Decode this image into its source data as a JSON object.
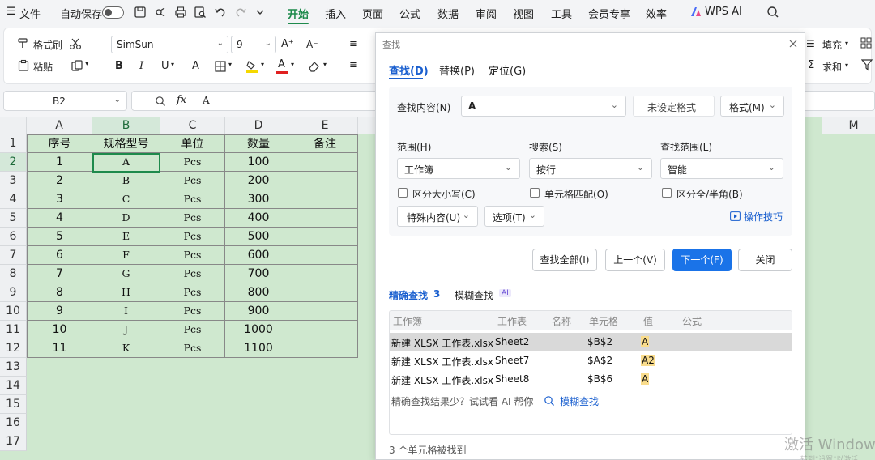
{
  "menubar": {
    "file": "文件",
    "autosave": "自动保存",
    "tabs": [
      "开始",
      "插入",
      "页面",
      "公式",
      "数据",
      "审阅",
      "视图",
      "工具",
      "会员专享",
      "效率"
    ],
    "wps_ai": "WPS AI"
  },
  "ribbon": {
    "format_painter": "格式刷",
    "paste": "粘贴",
    "font": "SimSun",
    "font_size": "9",
    "fill": "填充",
    "sum": "求和"
  },
  "formula_bar": {
    "name_box": "B2",
    "fx": "fx",
    "content": "A"
  },
  "sheet": {
    "columns": [
      "A",
      "B",
      "C",
      "D",
      "E",
      "M"
    ],
    "rows": [
      "1",
      "2",
      "3",
      "4",
      "5",
      "6",
      "7",
      "8",
      "9",
      "10",
      "11",
      "12",
      "13",
      "14",
      "15",
      "16",
      "17"
    ],
    "header_row": [
      "序号",
      "规格型号",
      "单位",
      "数量",
      "备注"
    ],
    "data": [
      [
        "1",
        "A",
        "Pcs",
        "100",
        ""
      ],
      [
        "2",
        "B",
        "Pcs",
        "200",
        ""
      ],
      [
        "3",
        "C",
        "Pcs",
        "300",
        ""
      ],
      [
        "4",
        "D",
        "Pcs",
        "400",
        ""
      ],
      [
        "5",
        "E",
        "Pcs",
        "500",
        ""
      ],
      [
        "6",
        "F",
        "Pcs",
        "600",
        ""
      ],
      [
        "7",
        "G",
        "Pcs",
        "700",
        ""
      ],
      [
        "8",
        "H",
        "Pcs",
        "800",
        ""
      ],
      [
        "9",
        "I",
        "Pcs",
        "900",
        ""
      ],
      [
        "10",
        "J",
        "Pcs",
        "1000",
        ""
      ],
      [
        "11",
        "K",
        "Pcs",
        "1100",
        ""
      ]
    ]
  },
  "dialog": {
    "title": "查找",
    "tabs": [
      "查找(D)",
      "替换(P)",
      "定位(G)"
    ],
    "find_label": "查找内容(N)",
    "find_value": "A",
    "format_status": "未设定格式",
    "format_button": "格式(M)",
    "scope_label": "范围(H)",
    "scope_value": "工作簿",
    "search_label": "搜索(S)",
    "search_value": "按行",
    "lookin_label": "查找范围(L)",
    "lookin_value": "智能",
    "match_case": "区分大小写(C)",
    "match_cell": "单元格匹配(O)",
    "match_width": "区分全/半角(B)",
    "special": "特殊内容(U)",
    "options": "选项(T)",
    "tips": "操作技巧",
    "find_all": "查找全部(I)",
    "prev": "上一个(V)",
    "next": "下一个(F)",
    "close": "关闭",
    "mode_exact": "精确查找",
    "mode_exact_count": "3",
    "mode_fuzzy": "模糊查找",
    "ai_badge": "AI",
    "result_headers": [
      "工作簿",
      "工作表",
      "名称",
      "单元格",
      "值",
      "公式"
    ],
    "results": [
      {
        "workbook": "新建 XLSX 工作表.xlsx",
        "sheet": "Sheet2",
        "cell": "$B$2",
        "value": "A"
      },
      {
        "workbook": "新建 XLSX 工作表.xlsx",
        "sheet": "Sheet7",
        "cell": "$A$2",
        "value": "A2"
      },
      {
        "workbook": "新建 XLSX 工作表.xlsx",
        "sheet": "Sheet8",
        "cell": "$B$6",
        "value": "A"
      }
    ],
    "ai_hint": "精确查找结果少？试试看 AI 帮你",
    "ai_hint_link": "模糊查找",
    "status": "3 个单元格被找到"
  },
  "watermark": "激活 Windows",
  "watermark_sub": "转到\"设置\"以激活"
}
